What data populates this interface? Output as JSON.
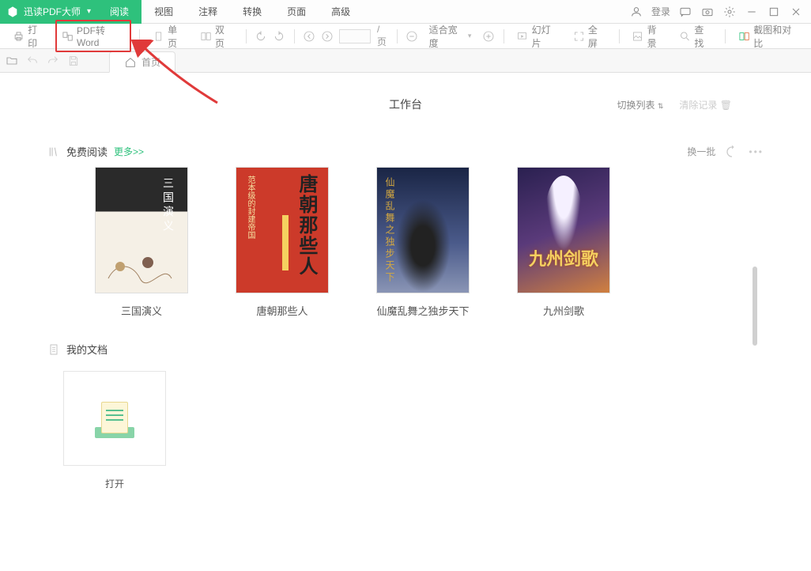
{
  "app": {
    "title": "迅读PDF大师"
  },
  "menu": {
    "items": [
      {
        "label": "阅读"
      },
      {
        "label": "视图"
      },
      {
        "label": "注释"
      },
      {
        "label": "转换"
      },
      {
        "label": "页面"
      },
      {
        "label": "高级"
      }
    ],
    "active_index": 0
  },
  "topright": {
    "login": "登录"
  },
  "toolbar": {
    "print": "打印",
    "pdf2word": "PDF转Word",
    "single_page": "单页",
    "double_page": "双页",
    "page_total_label": "/页",
    "zoom_fit": "适合宽度",
    "slideshow": "幻灯片",
    "fullscreen": "全屏",
    "background": "背景",
    "find": "查找",
    "screenshot_compare": "截图和对比"
  },
  "secondbar": {
    "home": "首页"
  },
  "home": {
    "center_title": "工作台",
    "switch_list": "切换列表",
    "clear_history": "清除记录"
  },
  "free_read": {
    "title": "免费阅读",
    "more": "更多>>",
    "refresh": "换一批",
    "books": [
      {
        "title": "三国演义",
        "cover_text": "三国演义"
      },
      {
        "title": "唐朝那些人",
        "cover_text": "唐朝那些人",
        "subtitle": "范本级的封建帝国"
      },
      {
        "title": "仙魔乱舞之独步天下",
        "cover_text": "仙魔乱舞之独步天下"
      },
      {
        "title": "九州剑歌",
        "cover_text": "九州剑歌"
      }
    ]
  },
  "mydocs": {
    "title": "我的文档",
    "open_label": "打开"
  }
}
